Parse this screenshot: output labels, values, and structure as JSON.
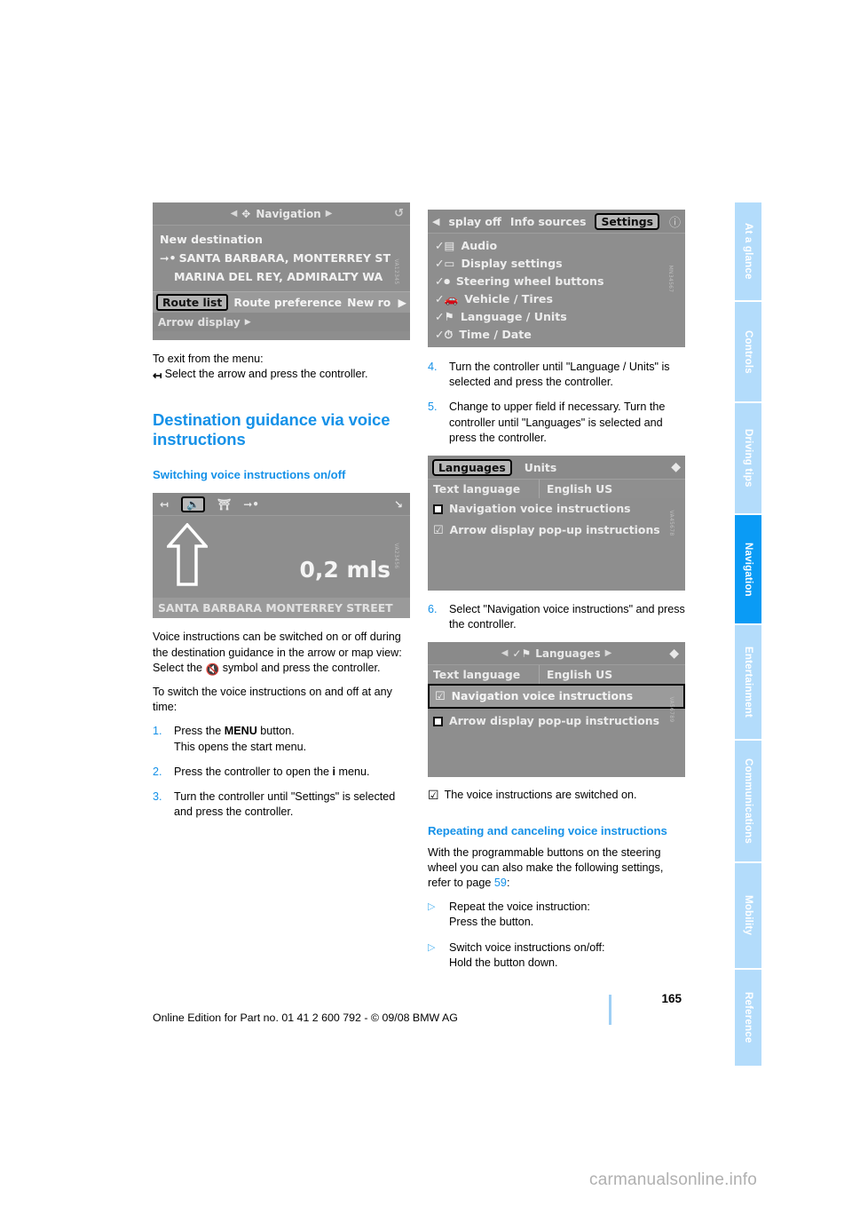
{
  "document": {
    "page_number": "165",
    "edition_line": "Online Edition for Part no. 01 41 2 600 792 - © 09/08 BMW AG",
    "watermark": "carmanualsonline.info",
    "accent_blue": "#1591e8",
    "tab_blue": "#b3dcfb",
    "tab_active_blue": "#0a9bf5"
  },
  "sidebar": {
    "tabs": [
      {
        "label": "At a glance",
        "active": false
      },
      {
        "label": "Controls",
        "active": false
      },
      {
        "label": "Driving tips",
        "active": false
      },
      {
        "label": "Navigation",
        "active": true
      },
      {
        "label": "Entertainment",
        "active": false
      },
      {
        "label": "Communications",
        "active": false
      },
      {
        "label": "Mobility",
        "active": false
      },
      {
        "label": "Reference",
        "active": false
      }
    ]
  },
  "left_column": {
    "nav_screenshot": {
      "title": "Navigation",
      "rows": [
        "New destination",
        "SANTA BARBARA, MONTERREY ST",
        "MARINA DEL REY, ADMIRALTY WA"
      ],
      "tags": [
        "Route list",
        "Route preference",
        "New ro"
      ],
      "selected_tag": "Route list",
      "footer": "Arrow display"
    },
    "exit_note_title": "To exit from the menu:",
    "exit_note_text": "Select the arrow and press the controller.",
    "heading": "Destination guidance via voice instructions",
    "subheading": "Switching voice instructions on/off",
    "arrow_screenshot": {
      "distance": "0,2 mls",
      "street": "SANTA BARBARA MONTERREY STREET"
    },
    "para1": "Voice instructions can be switched on or off during the destination guidance in the arrow or map view:",
    "para2_prefix": "Select the",
    "para2_suffix": "symbol and press the controller.",
    "para3": "To switch the voice instructions on and off at any time:",
    "steps": [
      {
        "num": "1.",
        "line1_prefix": "Press the ",
        "line1_bold": "MENU",
        "line1_suffix": " button.",
        "line2": "This opens the start menu."
      },
      {
        "num": "2.",
        "line1_prefix": "Press the controller to open the ",
        "line1_bold": "i",
        "line1_suffix": " menu.",
        "line2": ""
      },
      {
        "num": "3.",
        "line1_prefix": "Turn the controller until \"Settings\" is selected and press the controller.",
        "line1_bold": "",
        "line1_suffix": "",
        "line2": ""
      }
    ]
  },
  "right_column": {
    "settings_screenshot": {
      "tabs": [
        "splay off",
        "Info sources",
        "Settings"
      ],
      "selected_tab": "Settings",
      "menu_items": [
        "Audio",
        "Display settings",
        "Steering wheel buttons",
        "Vehicle / Tires",
        "Language / Units",
        "Time / Date"
      ]
    },
    "steps_upper": [
      {
        "num": "4.",
        "text": "Turn the controller until \"Language / Units\" is selected and press the controller."
      },
      {
        "num": "5.",
        "text": "Change to upper field if necessary. Turn the controller until \"Languages\" is selected and press the controller."
      }
    ],
    "languages_screenshot_1": {
      "tabs": [
        "Languages",
        "Units"
      ],
      "selected_tab": "Languages",
      "field_label": "Text language",
      "field_value": "English US",
      "options": [
        {
          "label": "Navigation voice instructions",
          "checked": false,
          "highlighted": false
        },
        {
          "label": "Arrow display pop-up instructions",
          "checked": true,
          "highlighted": false
        }
      ]
    },
    "step6": {
      "num": "6.",
      "text": "Select \"Navigation voice instructions\" and press the controller."
    },
    "languages_screenshot_2": {
      "title": "Languages",
      "field_label": "Text language",
      "field_value": "English US",
      "options": [
        {
          "label": "Navigation voice instructions",
          "checked": true,
          "highlighted": true
        },
        {
          "label": "Arrow display pop-up instructions",
          "checked": false,
          "highlighted": false
        }
      ]
    },
    "result_text": "The voice instructions are switched on.",
    "subheading2": "Repeating and canceling voice instructions",
    "para_prefix": "With the programmable buttons on the steering wheel you can also make the following settings, refer to page ",
    "para_link": "59",
    "para_suffix": ":",
    "bullets": [
      {
        "line1": "Repeat the voice instruction:",
        "line2": "Press the button."
      },
      {
        "line1": "Switch voice instructions on/off:",
        "line2": "Hold the button down."
      }
    ]
  }
}
